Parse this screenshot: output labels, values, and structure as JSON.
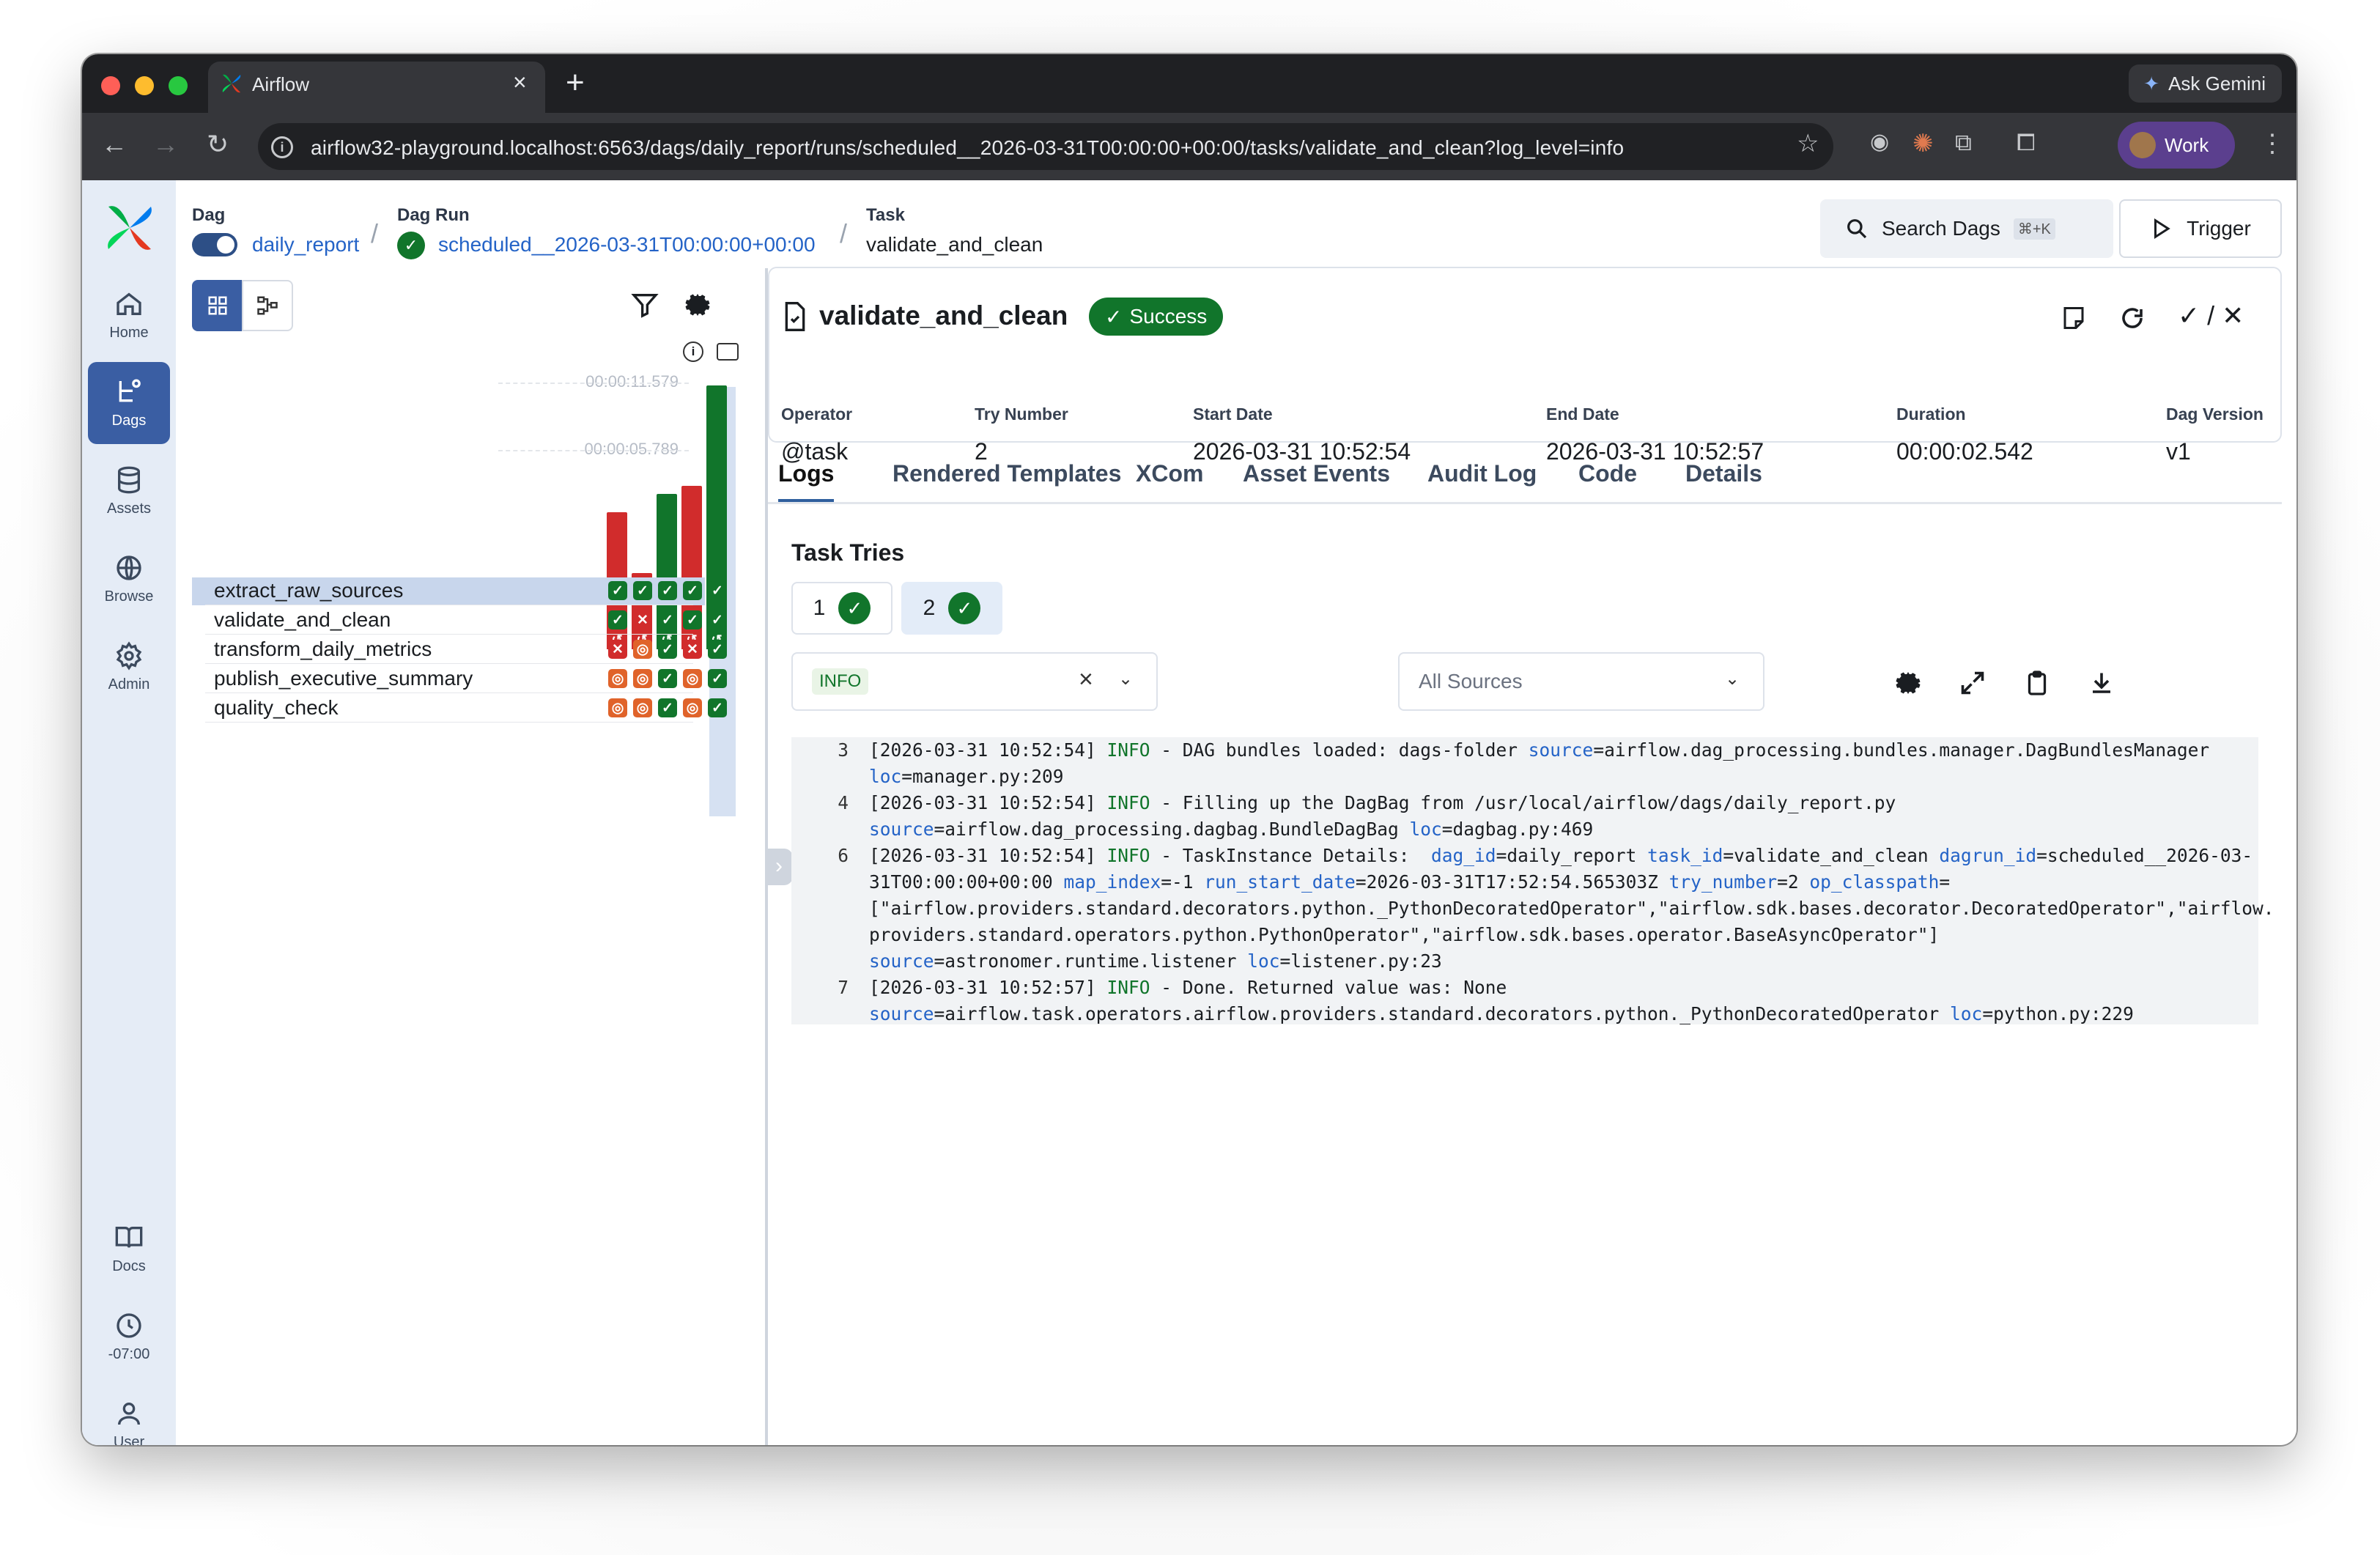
{
  "browser": {
    "tab_title": "Airflow",
    "url": "airflow32-playground.localhost:6563/dags/daily_report/runs/scheduled__2026-03-31T00:00:00+00:00/tasks/validate_and_clean?log_level=info",
    "ask_gemini": "Ask Gemini",
    "profile": "Work"
  },
  "nav": {
    "home": "Home",
    "dags": "Dags",
    "assets": "Assets",
    "browse": "Browse",
    "admin": "Admin",
    "docs": "Docs",
    "timezone": "-07:00",
    "user": "User"
  },
  "breadcrumb": {
    "dag_label": "Dag",
    "dag_value": "daily_report",
    "run_label": "Dag Run",
    "run_value": "scheduled__2026-03-31T00:00:00+00:00",
    "task_label": "Task",
    "task_value": "validate_and_clean"
  },
  "header": {
    "search": "Search Dags",
    "search_kbd": "⌘+K",
    "trigger": "Trigger"
  },
  "grid": {
    "duration_max": "00:00:11.579",
    "duration_mid": "00:00:05.789",
    "runs": [
      {
        "duration_ratio": 0.52,
        "state": "failed"
      },
      {
        "duration_ratio": 0.29,
        "state": "failed"
      },
      {
        "duration_ratio": 0.59,
        "state": "success"
      },
      {
        "duration_ratio": 0.62,
        "state": "failed"
      },
      {
        "duration_ratio": 1.0,
        "state": "success"
      }
    ],
    "tasks": [
      {
        "name": "extract_raw_sources",
        "states": [
          "success",
          "success",
          "success",
          "success",
          "success"
        ]
      },
      {
        "name": "validate_and_clean",
        "states": [
          "success",
          "failed",
          "success",
          "success",
          "success"
        ]
      },
      {
        "name": "transform_daily_metrics",
        "states": [
          "failed",
          "upstream_failed",
          "success",
          "failed",
          "success"
        ]
      },
      {
        "name": "publish_executive_summary",
        "states": [
          "upstream_failed",
          "upstream_failed",
          "success",
          "upstream_failed",
          "success"
        ]
      },
      {
        "name": "quality_check",
        "states": [
          "upstream_failed",
          "upstream_failed",
          "success",
          "upstream_failed",
          "success"
        ]
      }
    ]
  },
  "task": {
    "title": "validate_and_clean",
    "status": "Success",
    "operator_label": "Operator",
    "operator": "@task",
    "try_label": "Try Number",
    "try_number": "2",
    "start_label": "Start Date",
    "start": "2026-03-31 10:52:54",
    "end_label": "End Date",
    "end": "2026-03-31 10:52:57",
    "duration_label": "Duration",
    "duration": "00:00:02.542",
    "version_label": "Dag Version",
    "version": "v1"
  },
  "tabs": [
    "Logs",
    "Rendered Templates",
    "XCom",
    "Asset Events",
    "Audit Log",
    "Code",
    "Details"
  ],
  "logs": {
    "tries_title": "Task Tries",
    "try1": "1",
    "try2": "2",
    "level_filter": "INFO",
    "sources_filter": "All Sources"
  },
  "colors": {
    "success": "#11752b",
    "failed": "#d12c2c",
    "upstream_failed": "#e0632a",
    "accent": "#3a5ea3"
  }
}
